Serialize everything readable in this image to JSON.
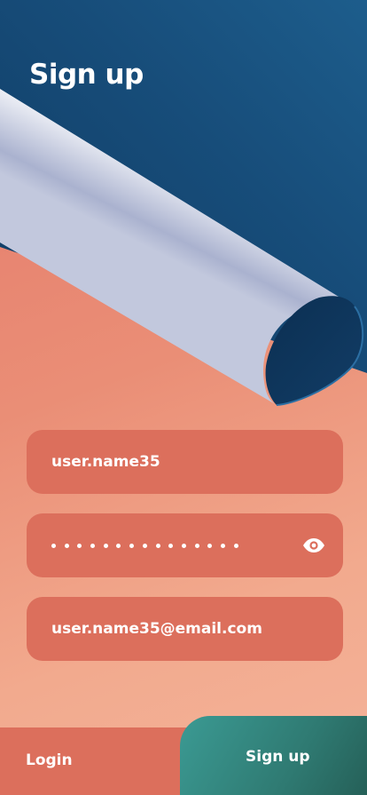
{
  "header": {
    "title": "Sign up"
  },
  "form": {
    "username_value": "user.name35",
    "password_masked": true,
    "password_dot_count": 15,
    "email_value": "user.name35@email.com"
  },
  "actions": {
    "login_label": "Login",
    "signup_label": "Sign up"
  },
  "icons": {
    "password_toggle": "eye-icon"
  },
  "colors": {
    "background_top": "#1a4f7a",
    "background_bottom": "#e4786a",
    "field_fill": "#dc6f5c",
    "signup_button": "#2f7a72",
    "text": "#ffffff"
  }
}
